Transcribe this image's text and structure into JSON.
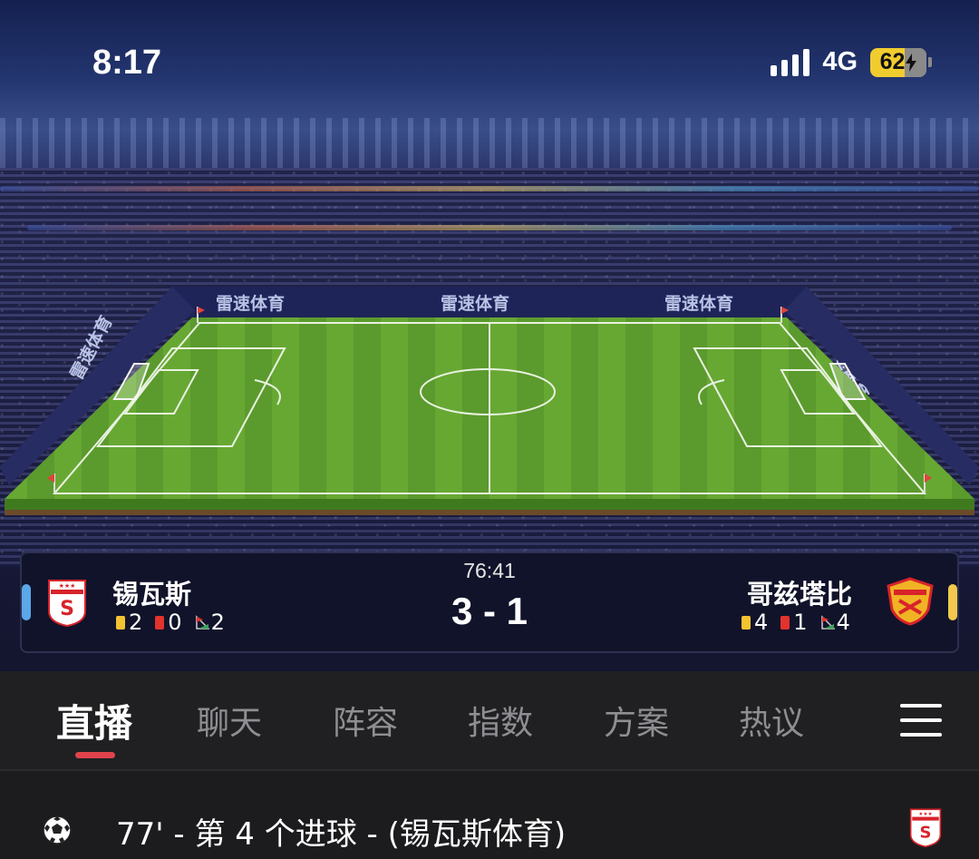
{
  "status_bar": {
    "time": "8:17",
    "network": "4G",
    "battery": "62"
  },
  "stadium_boards": [
    "雷速体育",
    "雷速体育",
    "雷速体育",
    "雷速体育"
  ],
  "match": {
    "clock": "76:41",
    "score": "3 - 1",
    "home": {
      "name": "锡瓦斯",
      "yellow": "2",
      "red": "0",
      "corners": "2",
      "color": "#5aa8e8"
    },
    "away": {
      "name": "哥兹塔比",
      "yellow": "4",
      "red": "1",
      "corners": "4",
      "color": "#f2c94c"
    }
  },
  "tabs": [
    {
      "label": "直播",
      "active": true
    },
    {
      "label": "聊天",
      "active": false
    },
    {
      "label": "阵容",
      "active": false
    },
    {
      "label": "指数",
      "active": false
    },
    {
      "label": "方案",
      "active": false
    },
    {
      "label": "热议",
      "active": false
    }
  ],
  "events": [
    {
      "text": "77' - 第 4 个进球 - (锡瓦斯体育)",
      "icon": "soccer-ball-icon"
    }
  ],
  "colors": {
    "accent": "#e0434b",
    "card_bg": "#11132a",
    "tab_bg": "#202022"
  }
}
